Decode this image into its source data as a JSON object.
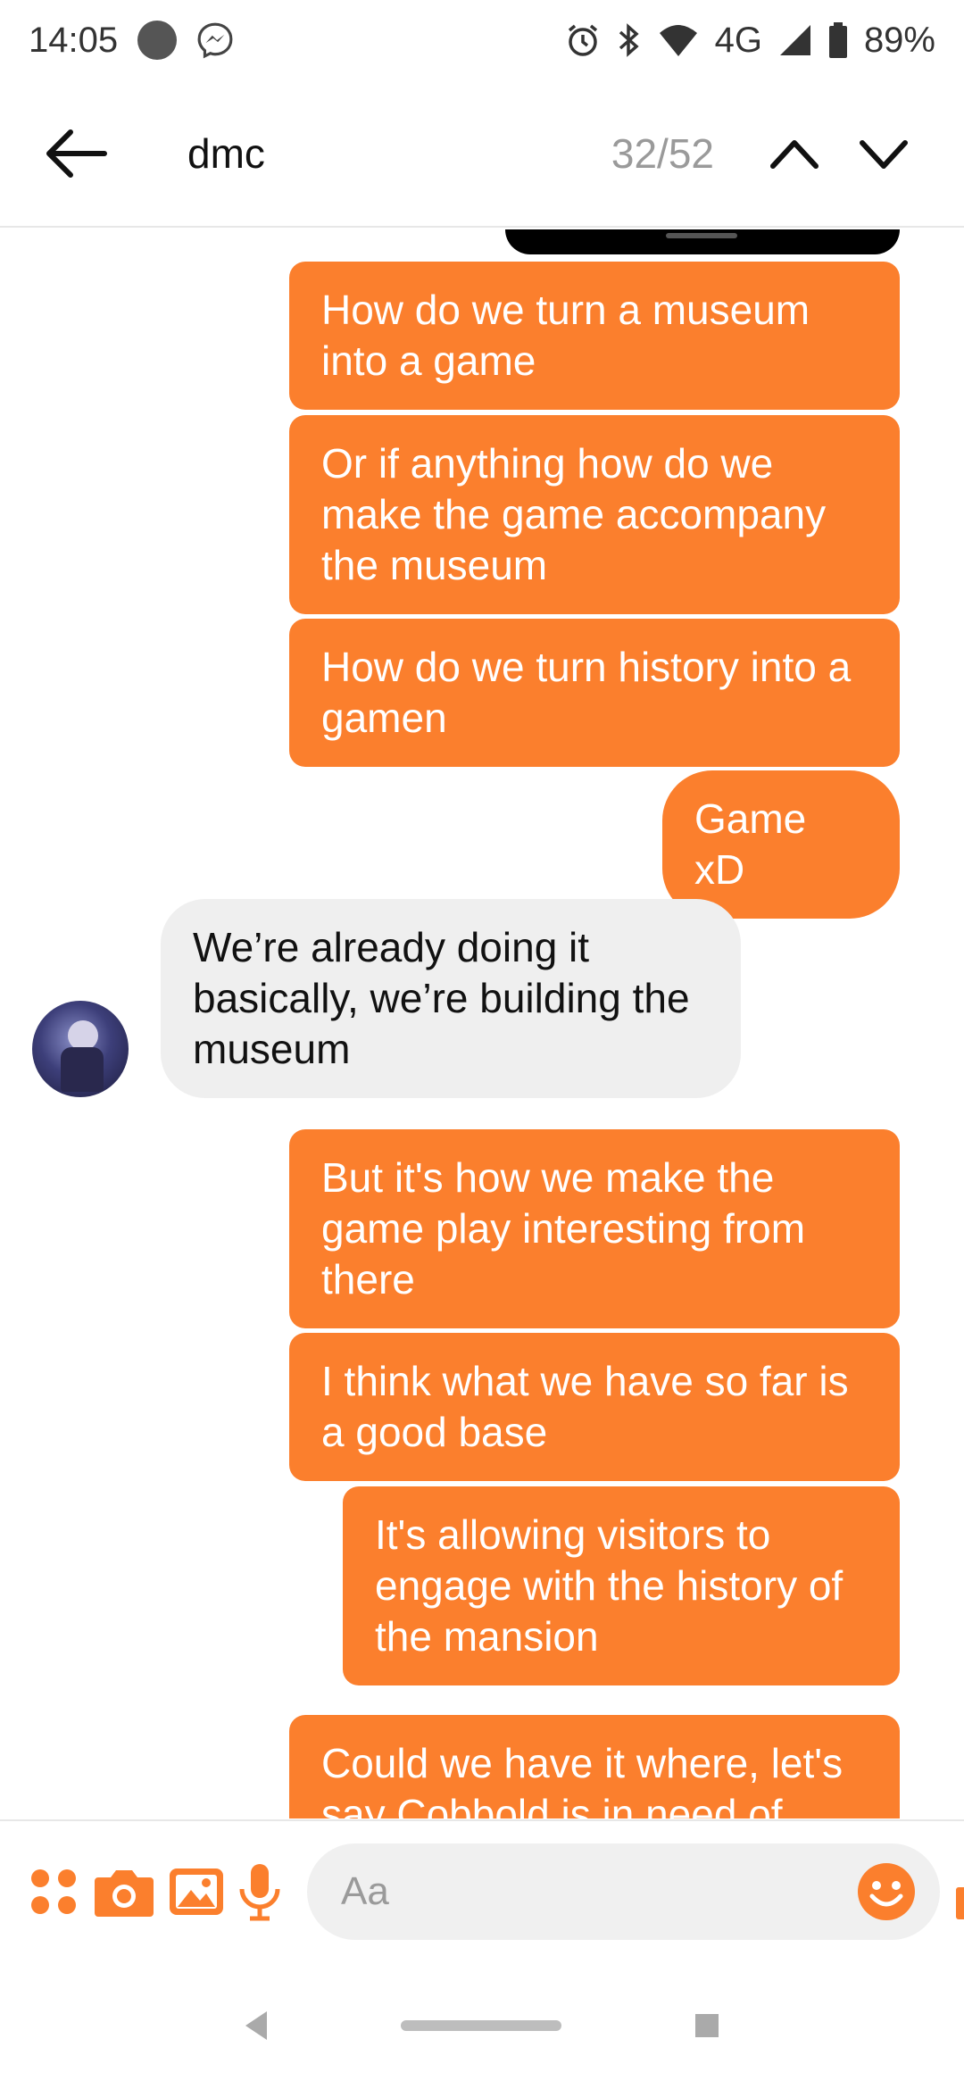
{
  "status_bar": {
    "time": "14:05",
    "network": "4G",
    "battery": "89%"
  },
  "header": {
    "search_term": "dmc",
    "counter": "32/52"
  },
  "messages": [
    {
      "direction": "out",
      "text": "How do we turn a museum into a game"
    },
    {
      "direction": "out",
      "text": "Or if anything how do we make the game accompany the museum"
    },
    {
      "direction": "out",
      "text": "How do we turn history into a gamen"
    },
    {
      "direction": "out",
      "text": "Game xD"
    },
    {
      "direction": "in",
      "text": "We’re already doing it basically, we’re building the museum"
    },
    {
      "direction": "out",
      "text": "But it's how we make the game play interesting from there"
    },
    {
      "direction": "out",
      "text": "I think what we have so far is a good base"
    },
    {
      "direction": "out",
      "text": "It's allowing visitors to engage with the history of the mansion"
    },
    {
      "direction": "out",
      "text": "Could we have it where, let's say Cobbold is in need of"
    }
  ],
  "composer": {
    "placeholder": "Aa",
    "icons": [
      "apps-icon",
      "camera-icon",
      "image-icon",
      "microphone-icon",
      "emoji-icon",
      "thumbs-up-icon"
    ]
  },
  "colors": {
    "accent": "#fb7f2d",
    "incoming_bubble": "#efefef"
  }
}
